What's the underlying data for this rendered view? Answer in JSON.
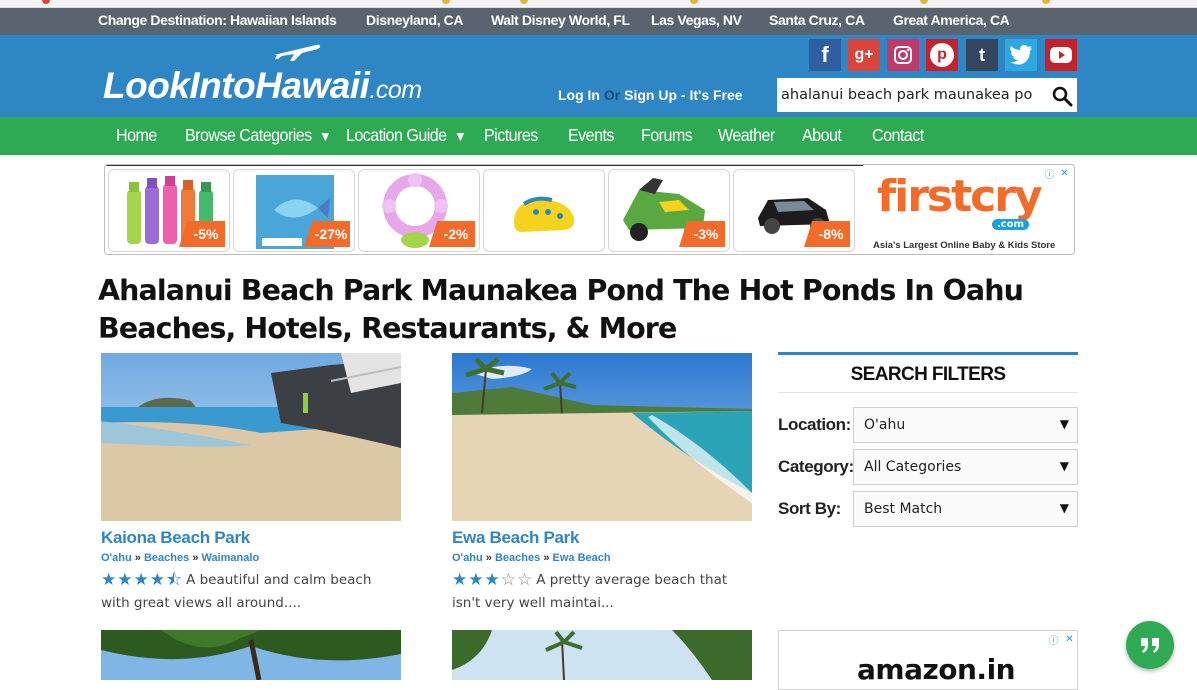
{
  "destination_bar": {
    "label": "Change Destination:",
    "items": [
      "Hawaiian Islands",
      "Disneyland, CA",
      "Walt Disney World, FL",
      "Las Vegas, NV",
      "Santa Cruz, CA",
      "Great America, CA"
    ]
  },
  "header": {
    "logo_main": "LookIntoHawaii",
    "logo_suffix": ".com",
    "login": "Log In",
    "or": "Or",
    "signup": "Sign Up - It's Free",
    "search_value": "ahalanui beach park maunakea po",
    "social_icons": [
      "facebook-icon",
      "google-plus-icon",
      "instagram-icon",
      "pinterest-icon",
      "tumblr-icon",
      "twitter-icon",
      "youtube-icon"
    ],
    "social_glyphs": [
      "f",
      "g+",
      "",
      "p",
      "t",
      "",
      ""
    ]
  },
  "nav": {
    "items": [
      "Home",
      "Browse Categories",
      "Location Guide",
      "Pictures",
      "Events",
      "Forums",
      "Weather",
      "About",
      "Contact"
    ]
  },
  "ad": {
    "discounts": [
      "-5%",
      "-27%",
      "-2%",
      "",
      "-3%",
      "-8%"
    ],
    "brand": "firstcry",
    "brand_suffix": ".com",
    "tagline": "Asia's Largest Online Baby & Kids Store"
  },
  "page_title": "Ahalanui Beach Park Maunakea Pond The Hot Ponds In Oahu Beaches, Hotels, Restaurants, & More",
  "results": [
    {
      "title": "Kaiona Beach Park",
      "crumbs": [
        "O'ahu",
        "Beaches",
        "Waimanalo"
      ],
      "rating": 4.5,
      "stars_full": "★★★★",
      "stars_half": "⯪",
      "stars_empty": "",
      "description": "A beautiful and calm beach with great views all around...."
    },
    {
      "title": "Ewa Beach Park",
      "crumbs": [
        "O'ahu",
        "Beaches",
        "Ewa Beach"
      ],
      "rating": 3,
      "stars_full": "★★★",
      "stars_half": "",
      "stars_empty": "☆☆",
      "description": "A pretty average beach that isn't very well maintai..."
    }
  ],
  "crumb_separator": "»",
  "filters": {
    "heading": "SEARCH FILTERS",
    "location_label": "Location:",
    "location_value": "O'ahu",
    "category_label": "Category:",
    "category_value": "All Categories",
    "sort_label": "Sort By:",
    "sort_value": "Best Match"
  },
  "ad2": {
    "brand": "amazon.in"
  },
  "colors": {
    "primary_blue": "#2f86c5",
    "nav_green": "#2eaa55",
    "dest_bar": "#5a6470",
    "discount_orange": "#f36b2b"
  }
}
